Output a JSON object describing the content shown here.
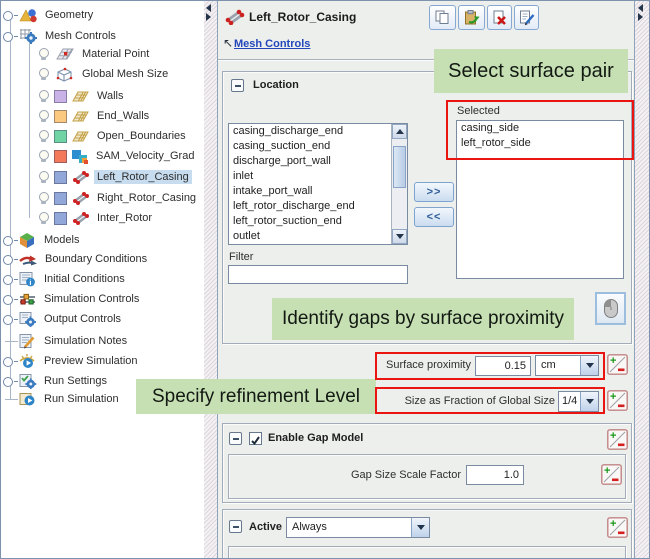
{
  "colors": {
    "annotation_green": "#c6e0b4",
    "annotation_red": "#ea1410",
    "selection_blue": "#c8dcf0"
  },
  "tree": {
    "items": [
      {
        "label": "Geometry"
      },
      {
        "label": "Mesh Controls"
      },
      {
        "label": "Material Point"
      },
      {
        "label": "Global Mesh Size"
      },
      {
        "label": "Walls",
        "swatch": "#c9b3e6"
      },
      {
        "label": "End_Walls",
        "swatch": "#fbc97f"
      },
      {
        "label": "Open_Boundaries",
        "swatch": "#6fd3a4"
      },
      {
        "label": "SAM_Velocity_Grad",
        "swatch": "#f4795b"
      },
      {
        "label": "Left_Rotor_Casing",
        "swatch": "#92a8d8",
        "selected": true
      },
      {
        "label": "Right_Rotor_Casing",
        "swatch": "#92a8d8"
      },
      {
        "label": "Inter_Rotor",
        "swatch": "#92a8d8"
      },
      {
        "label": "Models"
      },
      {
        "label": "Boundary Conditions"
      },
      {
        "label": "Initial Conditions"
      },
      {
        "label": "Simulation Controls"
      },
      {
        "label": "Output Controls"
      },
      {
        "label": "Simulation Notes"
      },
      {
        "label": "Preview Simulation"
      },
      {
        "label": "Run Settings"
      },
      {
        "label": "Run Simulation"
      }
    ]
  },
  "panel": {
    "title": "Left_Rotor_Casing",
    "breadcrumb": "Mesh Controls",
    "toolbar_icons": [
      "copy-icon",
      "paste-icon",
      "delete-icon",
      "edit-icon"
    ],
    "location": {
      "title": "Location",
      "available": [
        "casing_discharge_end",
        "casing_suction_end",
        "discharge_port_wall",
        "inlet",
        "intake_port_wall",
        "left_rotor_discharge_end",
        "left_rotor_suction_end",
        "outlet"
      ],
      "filter_label": "Filter",
      "filter_value": "",
      "selected_label": "Selected",
      "selected": [
        "casing_side",
        "left_rotor_side"
      ],
      "add_label": ">>",
      "remove_label": "<<"
    },
    "proximity": {
      "label": "Surface proximity",
      "value": "0.15",
      "unit": "cm"
    },
    "fraction": {
      "label": "Size as Fraction of Global Size",
      "value": "1/4"
    },
    "gap_model": {
      "label": "Enable Gap Model",
      "checked": true,
      "factor_label": "Gap Size Scale Factor",
      "factor_value": "1.0"
    },
    "active": {
      "label": "Active",
      "value": "Always"
    }
  },
  "annotations": [
    {
      "text": "Select surface pair"
    },
    {
      "text": "Identify gaps by surface proximity"
    },
    {
      "text": "Specify refinement Level"
    }
  ]
}
